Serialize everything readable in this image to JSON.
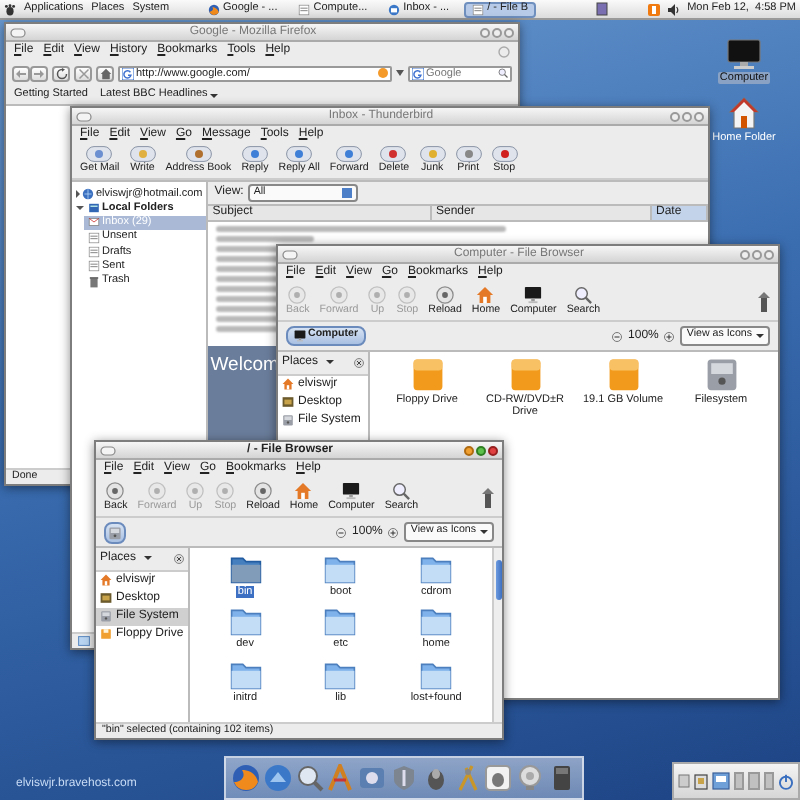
{
  "top_panel": {
    "menus": [
      "Applications",
      "Places",
      "System"
    ],
    "tasks": [
      {
        "label": "Google - ...",
        "kind": "browser",
        "selected": false
      },
      {
        "label": "Compute...",
        "kind": "files",
        "selected": false
      },
      {
        "label": "Inbox - ...",
        "kind": "mail",
        "selected": false
      },
      {
        "label": "/ - File B",
        "kind": "files",
        "selected": true
      }
    ],
    "clock": "Mon Feb 12,  4:58 PM"
  },
  "desktop_icons": [
    {
      "label": "Computer",
      "kind": "computer",
      "selected": true
    },
    {
      "label": "Home Folder",
      "kind": "home",
      "selected": false
    }
  ],
  "firefox": {
    "title": "Google - Mozilla Firefox",
    "active": false,
    "menu": [
      "File",
      "Edit",
      "View",
      "History",
      "Bookmarks",
      "Tools",
      "Help"
    ],
    "url": "http://www.google.com/",
    "search_placeholder": "Google",
    "bookmarks": [
      "Getting Started",
      "Latest BBC Headlines"
    ],
    "status": "Done"
  },
  "thunderbird": {
    "title": "Inbox - Thunderbird",
    "active": false,
    "menu": [
      "File",
      "Edit",
      "View",
      "Go",
      "Message",
      "Tools",
      "Help"
    ],
    "toolbar": [
      "Get Mail",
      "Write",
      "Address Book",
      "Reply",
      "Reply All",
      "Forward",
      "Delete",
      "Junk",
      "Print",
      "Stop"
    ],
    "folders": [
      {
        "label": "elviswjr@hotmail.com",
        "kind": "account",
        "expanded": false,
        "selected": false
      },
      {
        "label": "Local Folders",
        "kind": "local",
        "expanded": true,
        "selected": false,
        "children": [
          {
            "label": "Inbox (29)",
            "kind": "inbox",
            "selected": true
          },
          {
            "label": "Unsent",
            "kind": "folder",
            "selected": false
          },
          {
            "label": "Drafts",
            "kind": "folder",
            "selected": false
          },
          {
            "label": "Sent",
            "kind": "folder",
            "selected": false
          },
          {
            "label": "Trash",
            "kind": "trash",
            "selected": false
          }
        ]
      }
    ],
    "view_label": "View:",
    "view_value": "All",
    "columns": [
      {
        "label": "Subject",
        "selected": false
      },
      {
        "label": "Sender",
        "selected": false
      },
      {
        "label": "Date",
        "selected": true
      }
    ],
    "welcome": "Welcom"
  },
  "computer_browser": {
    "title": "Computer - File Browser",
    "active": false,
    "menu": [
      "File",
      "Edit",
      "View",
      "Go",
      "Bookmarks",
      "Help"
    ],
    "toolbar": [
      {
        "label": "Back",
        "kind": "round",
        "disabled": true
      },
      {
        "label": "Forward",
        "kind": "round",
        "disabled": true
      },
      {
        "label": "Up",
        "kind": "round",
        "disabled": true
      },
      {
        "label": "Stop",
        "kind": "round",
        "disabled": true
      },
      {
        "label": "Reload",
        "kind": "round",
        "disabled": false
      },
      {
        "label": "Home",
        "kind": "home",
        "disabled": false
      },
      {
        "label": "Computer",
        "kind": "computer",
        "disabled": false
      },
      {
        "label": "Search",
        "kind": "search",
        "disabled": false
      }
    ],
    "location": "Computer",
    "zoom": "100%",
    "view_mode": "View as Icons",
    "places_header": "Places",
    "places": [
      {
        "label": "elviswjr",
        "kind": "home",
        "selected": false
      },
      {
        "label": "Desktop",
        "kind": "desktop",
        "selected": false
      },
      {
        "label": "File System",
        "kind": "disk",
        "selected": false
      }
    ],
    "items": [
      {
        "label": "Floppy Drive",
        "kind": "drive",
        "selected": false
      },
      {
        "label": "CD-RW/DVD±R Drive",
        "kind": "drive",
        "selected": false
      },
      {
        "label": "19.1 GB Volume",
        "kind": "drive",
        "selected": false
      },
      {
        "label": "Filesystem",
        "kind": "disk",
        "selected": false
      }
    ]
  },
  "root_browser": {
    "title": "/ - File Browser",
    "active": true,
    "menu": [
      "File",
      "Edit",
      "View",
      "Go",
      "Bookmarks",
      "Help"
    ],
    "toolbar": [
      {
        "label": "Back",
        "kind": "round",
        "disabled": false
      },
      {
        "label": "Forward",
        "kind": "round",
        "disabled": true
      },
      {
        "label": "Up",
        "kind": "round",
        "disabled": true
      },
      {
        "label": "Stop",
        "kind": "round",
        "disabled": true
      },
      {
        "label": "Reload",
        "kind": "round",
        "disabled": false
      },
      {
        "label": "Home",
        "kind": "home",
        "disabled": false
      },
      {
        "label": "Computer",
        "kind": "computer",
        "disabled": false
      },
      {
        "label": "Search",
        "kind": "search",
        "disabled": false
      }
    ],
    "zoom": "100%",
    "view_mode": "View as Icons",
    "places_header": "Places",
    "places": [
      {
        "label": "elviswjr",
        "kind": "home",
        "selected": false
      },
      {
        "label": "Desktop",
        "kind": "desktop",
        "selected": false
      },
      {
        "label": "File System",
        "kind": "disk",
        "selected": true
      },
      {
        "label": "Floppy Drive",
        "kind": "floppy",
        "selected": false
      }
    ],
    "items": [
      {
        "label": "bin",
        "kind": "folder",
        "selected": true
      },
      {
        "label": "boot",
        "kind": "folder",
        "selected": false
      },
      {
        "label": "cdrom",
        "kind": "folder",
        "selected": false
      },
      {
        "label": "dev",
        "kind": "folder",
        "selected": false
      },
      {
        "label": "etc",
        "kind": "folder",
        "selected": false
      },
      {
        "label": "home",
        "kind": "folder",
        "selected": false
      },
      {
        "label": "initrd",
        "kind": "folder",
        "selected": false
      },
      {
        "label": "lib",
        "kind": "folder",
        "selected": false
      },
      {
        "label": "lost+found",
        "kind": "folder",
        "selected": false
      }
    ],
    "status": "\"bin\" selected (containing 102 items)"
  },
  "footer": "elviswjr.bravehost.com"
}
